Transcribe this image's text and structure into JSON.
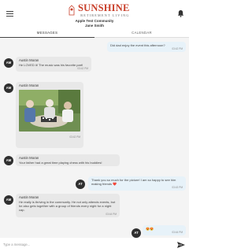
{
  "header": {
    "brand": "SUNSHINE",
    "tagline": "RETIREMENT LIVING",
    "community": "Apple Test Community",
    "resident": "Jane Smith",
    "brand_color": "#c9402b"
  },
  "tabs": [
    {
      "label": "MESSAGES",
      "active": true
    },
    {
      "label": "CALENDAR",
      "active": false
    }
  ],
  "messages": [
    {
      "direction": "outgoing",
      "initials": "AT",
      "text": "Did dad enjoy the event this afternoon?",
      "time": "03:42 PM"
    },
    {
      "direction": "incoming",
      "initials": "AM",
      "sender": "Austin Moran",
      "text": "He LOVED it! The music was his favorite part!",
      "time": "03:42 PM"
    },
    {
      "direction": "incoming",
      "initials": "AM",
      "sender": "Austin Moran",
      "image": "photo-seniors-playing-chess",
      "time": "03:42 PM"
    },
    {
      "direction": "incoming",
      "initials": "AM",
      "sender": "Austin Moran",
      "text": "Your father had a great time playing chess with his buddies!",
      "time": "03:43 PM"
    },
    {
      "direction": "outgoing",
      "initials": "AT",
      "text": "Thank you so much for the picture! I am so happy to see him making friends ❤️",
      "time": "03:43 PM"
    },
    {
      "direction": "incoming",
      "initials": "AM",
      "sender": "Austin Moran",
      "text": "He really is thriving in the community. He not only attends events, but he also gets together with a group of friends every night for a night cap.",
      "time": "03:44 PM"
    },
    {
      "direction": "outgoing",
      "initials": "AT",
      "text": "😍😍",
      "time": "03:44 PM"
    }
  ],
  "composer": {
    "placeholder": "Type a message..."
  },
  "icons": {
    "menu": "hamburger-icon",
    "notifications": "bell-icon",
    "send": "send-icon"
  }
}
